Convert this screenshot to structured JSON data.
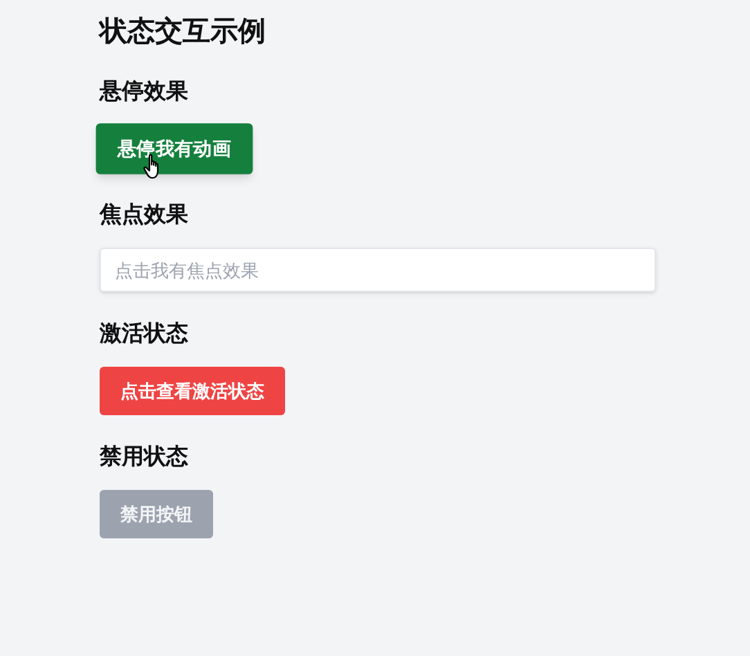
{
  "title": "状态交互示例",
  "sections": [
    {
      "heading": "悬停效果",
      "kind": "button",
      "label": "悬停我有动画",
      "color": "#15803d",
      "hovered": true,
      "disabled": false
    },
    {
      "heading": "焦点效果",
      "kind": "input",
      "placeholder": "点击我有焦点效果"
    },
    {
      "heading": "激活状态",
      "kind": "button",
      "label": "点击查看激活状态",
      "color": "#ef4444",
      "hovered": false,
      "disabled": false
    },
    {
      "heading": "禁用状态",
      "kind": "button",
      "label": "禁用按钮",
      "color": "#9ca3af",
      "hovered": false,
      "disabled": true
    }
  ]
}
